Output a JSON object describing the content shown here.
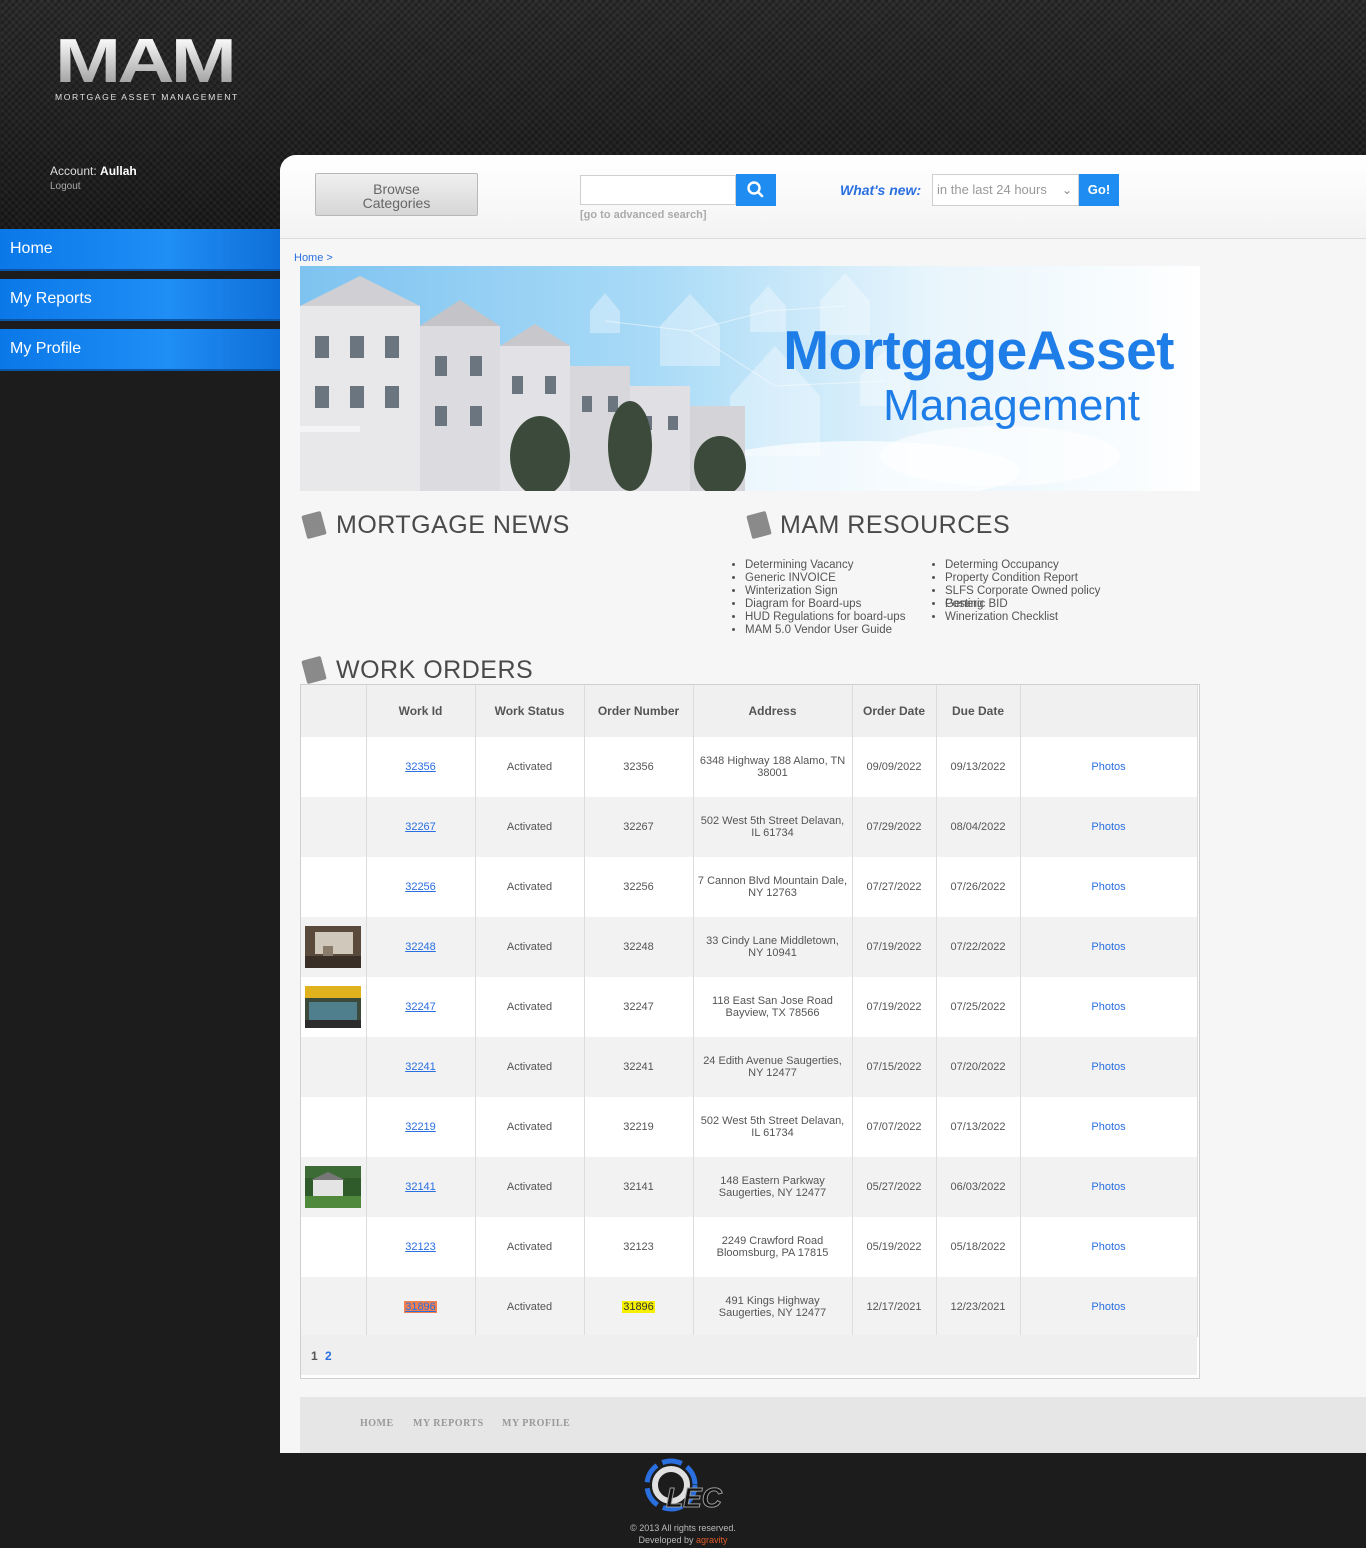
{
  "header": {
    "logo_text": "MAM",
    "logo_sub": "MORTGAGE ASSET MANAGEMENT",
    "account_label": "Account:",
    "account_name": "Aullah",
    "logout": "Logout"
  },
  "sidebar": {
    "items": [
      {
        "label": "Home"
      },
      {
        "label": "My Reports"
      },
      {
        "label": "My Profile"
      }
    ]
  },
  "topbar": {
    "browse_line1": "Browse",
    "browse_line2": "Categories",
    "search_placeholder": "",
    "advanced_search": "[go to advanced search]",
    "whats_new_label": "What's new:",
    "whats_new_selected": "in the last 24 hours",
    "go_label": "Go!"
  },
  "breadcrumb": "Home >",
  "banner": {
    "title_line1": "MortgageAsset",
    "title_line2": "Management"
  },
  "sections": {
    "news_title": "MORTGAGE NEWS",
    "resources_title": "MAM RESOURCES",
    "work_orders_title": "WORK ORDERS"
  },
  "resources": {
    "col1": [
      "Determining Vacancy",
      "Generic INVOICE",
      "Winterization Sign",
      "Diagram for Board-ups",
      "HUD Regulations for board-ups",
      "MAM 5.0 Vendor User Guide"
    ],
    "col2": [
      "Determing Occupancy",
      "Property Condition Report",
      "SLFS Corporate Owned policy",
      "Posting",
      "Generic BID",
      "Winerization Checklist"
    ]
  },
  "work_orders": {
    "columns": [
      "",
      "Work Id",
      "Work Status",
      "Order Number",
      "Address",
      "Order Date",
      "Due Date",
      ""
    ],
    "rows": [
      {
        "thumb": "",
        "work_id": "32356",
        "status": "Activated",
        "order_number": "32356",
        "address": "6348 Highway 188 Alamo, TN 38001",
        "order_date": "09/09/2022",
        "due_date": "09/13/2022",
        "action": "Photos"
      },
      {
        "thumb": "",
        "work_id": "32267",
        "status": "Activated",
        "order_number": "32267",
        "address": "502 West 5th Street Delavan, IL 61734",
        "order_date": "07/29/2022",
        "due_date": "08/04/2022",
        "action": "Photos"
      },
      {
        "thumb": "",
        "work_id": "32256",
        "status": "Activated",
        "order_number": "32256",
        "address": "7 Cannon Blvd Mountain Dale, NY 12763",
        "order_date": "07/27/2022",
        "due_date": "07/26/2022",
        "action": "Photos"
      },
      {
        "thumb": "interior",
        "work_id": "32248",
        "status": "Activated",
        "order_number": "32248",
        "address": "33 Cindy Lane Middletown, NY 10941",
        "order_date": "07/19/2022",
        "due_date": "07/22/2022",
        "action": "Photos"
      },
      {
        "thumb": "pool",
        "work_id": "32247",
        "status": "Activated",
        "order_number": "32247",
        "address": "118 East San Jose Road Bayview, TX 78566",
        "order_date": "07/19/2022",
        "due_date": "07/25/2022",
        "action": "Photos"
      },
      {
        "thumb": "",
        "work_id": "32241",
        "status": "Activated",
        "order_number": "32241",
        "address": "24 Edith Avenue Saugerties, NY 12477",
        "order_date": "07/15/2022",
        "due_date": "07/20/2022",
        "action": "Photos"
      },
      {
        "thumb": "",
        "work_id": "32219",
        "status": "Activated",
        "order_number": "32219",
        "address": "502 West 5th Street Delavan, IL 61734",
        "order_date": "07/07/2022",
        "due_date": "07/13/2022",
        "action": "Photos"
      },
      {
        "thumb": "house",
        "work_id": "32141",
        "status": "Activated",
        "order_number": "32141",
        "address": "148 Eastern Parkway Saugerties, NY 12477",
        "order_date": "05/27/2022",
        "due_date": "06/03/2022",
        "action": "Photos"
      },
      {
        "thumb": "",
        "work_id": "32123",
        "status": "Activated",
        "order_number": "32123",
        "address": "2249 Crawford Road Bloomsburg, PA 17815",
        "order_date": "05/19/2022",
        "due_date": "05/18/2022",
        "action": "Photos"
      },
      {
        "thumb": "",
        "work_id": "31896",
        "status": "Activated",
        "order_number": "31896",
        "address": "491 Kings Highway Saugerties, NY 12477",
        "order_date": "12/17/2021",
        "due_date": "12/23/2021",
        "action": "Photos",
        "highlight": true
      }
    ],
    "pages": [
      "1",
      "2"
    ]
  },
  "footer": {
    "links": [
      "HOME",
      "MY REPORTS",
      "MY PROFILE"
    ],
    "brand": "LEC",
    "copyright": "© 2013 All rights reserved.",
    "developed_by": "Developed by",
    "developer": "agravity"
  },
  "colors": {
    "accent": "#1e8cf0",
    "link": "#2a6fe0",
    "highlight_orange": "#f08050",
    "highlight_yellow": "#f6f000"
  }
}
